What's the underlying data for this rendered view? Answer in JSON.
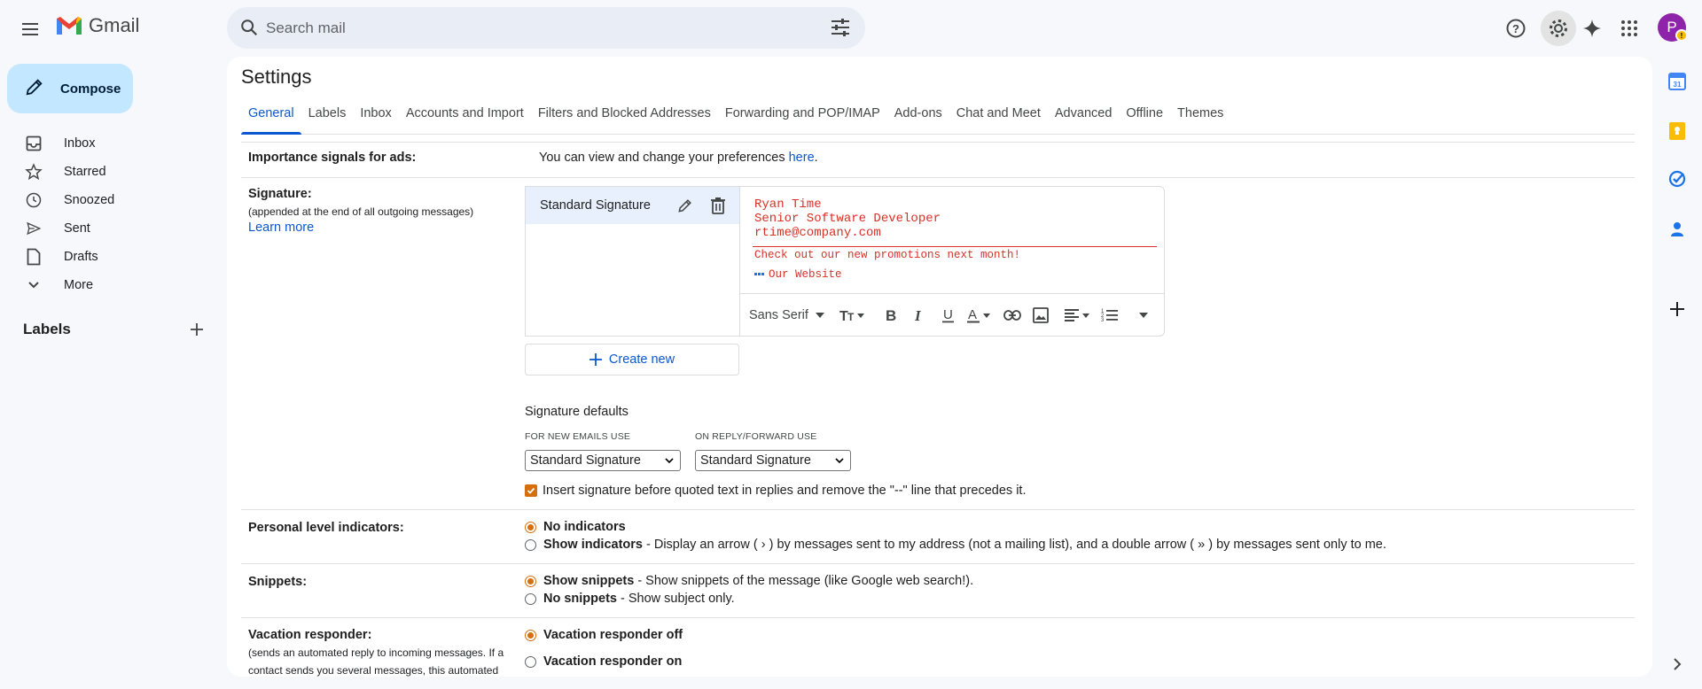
{
  "header": {
    "app_name": "Gmail",
    "search_placeholder": "Search mail",
    "avatar_letter": "P",
    "avatar_badge": "!"
  },
  "sidebar": {
    "compose_label": "Compose",
    "items": [
      {
        "label": "Inbox",
        "icon": "inbox-icon"
      },
      {
        "label": "Starred",
        "icon": "star-icon"
      },
      {
        "label": "Snoozed",
        "icon": "clock-icon"
      },
      {
        "label": "Sent",
        "icon": "send-icon"
      },
      {
        "label": "Drafts",
        "icon": "draft-icon"
      },
      {
        "label": "More",
        "icon": "chevron-down-icon"
      }
    ],
    "labels_header": "Labels"
  },
  "settings": {
    "title": "Settings",
    "tabs": [
      "General",
      "Labels",
      "Inbox",
      "Accounts and Import",
      "Filters and Blocked Addresses",
      "Forwarding and POP/IMAP",
      "Add-ons",
      "Chat and Meet",
      "Advanced",
      "Offline",
      "Themes"
    ],
    "active_tab": "General",
    "importance": {
      "label": "Importance signals for ads:",
      "text": "You can view and change your preferences ",
      "link": "here",
      "suffix": "."
    },
    "signature": {
      "label": "Signature:",
      "sublabel": "(appended at the end of all outgoing messages)",
      "learn_more": "Learn more",
      "list_item": "Standard Signature",
      "body_lines": "Ryan Time\nSenior Software Developer\nrtime@company.com",
      "promo": "Check out our new promotions next month!",
      "website": "Our Website",
      "font": "Sans Serif",
      "create_new": "Create new",
      "defaults_title": "Signature defaults",
      "new_emails_label": "FOR NEW EMAILS USE",
      "new_emails_value": "Standard Signature",
      "reply_label": "ON REPLY/FORWARD USE",
      "reply_value": "Standard Signature",
      "insert_before": "Insert signature before quoted text in replies and remove the \"--\" line that precedes it."
    },
    "personal_indicators": {
      "label": "Personal level indicators:",
      "opt1_bold": "No indicators",
      "opt2_bold": "Show indicators",
      "opt2_text": "- Display an arrow ( › ) by messages sent to my address (not a mailing list), and a double arrow ( » ) by messages sent only to me."
    },
    "snippets": {
      "label": "Snippets:",
      "opt1_bold": "Show snippets",
      "opt1_text": "- Show snippets of the message (like Google web search!).",
      "opt2_bold": "No snippets",
      "opt2_text": "- Show subject only."
    },
    "vacation": {
      "label": "Vacation responder:",
      "sublabel": "(sends an automated reply to incoming messages. If a contact sends you several messages, this automated",
      "opt1": "Vacation responder off",
      "opt2": "Vacation responder on"
    }
  },
  "colors": {
    "accent": "#0b57d0",
    "compose_bg": "#c2e7ff",
    "radio_checked": "#d56e0c",
    "signature_text": "#d93025"
  }
}
